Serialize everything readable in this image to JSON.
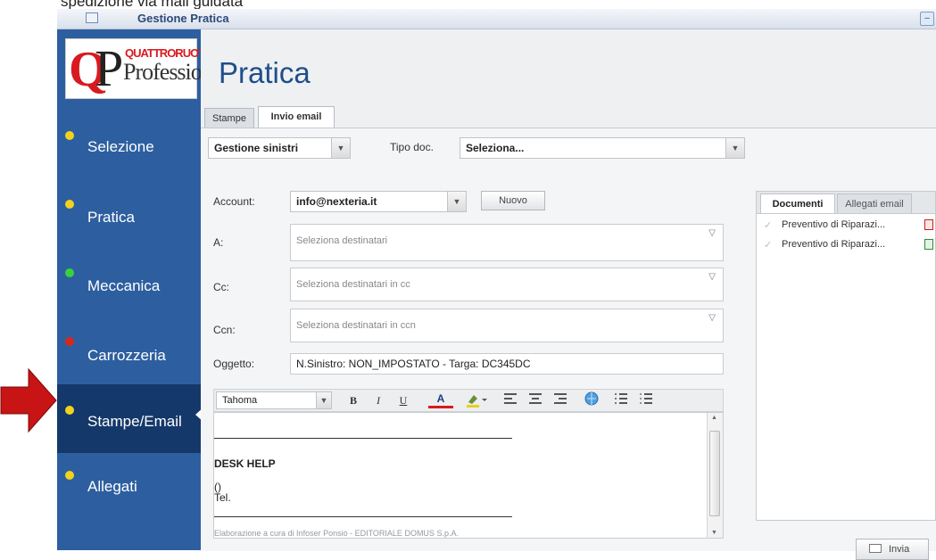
{
  "caption": "spedizione via mail guidata",
  "window": {
    "title": "Gestione Pratica",
    "minimize_label": "–"
  },
  "logo": {
    "q": "Q",
    "p": "P",
    "brand": "QUATTRORUOTE",
    "sub": "Professional"
  },
  "colors": {
    "sidebar": "#2d5fa0",
    "sidebar_active": "#14386a",
    "dot_yellow": "#f2d21b",
    "dot_green": "#3ccf3c",
    "dot_red": "#d8281c",
    "arrow": "#c81414"
  },
  "sidebar": {
    "items": [
      {
        "label": "Selezione",
        "status": "yellow"
      },
      {
        "label": "Pratica",
        "status": "yellow"
      },
      {
        "label": "Meccanica",
        "status": "green"
      },
      {
        "label": "Carrozzeria",
        "status": "red"
      },
      {
        "label": "Stampe/Email",
        "status": "yellow",
        "active": true
      },
      {
        "label": "Allegati",
        "status": "yellow"
      }
    ]
  },
  "page": {
    "title": "Pratica"
  },
  "tabs": [
    {
      "label": "Stampe"
    },
    {
      "label": "Invio email",
      "active": true
    }
  ],
  "filters": {
    "category_value": "Gestione sinistri",
    "doc_type_label": "Tipo doc.",
    "doc_type_value": "Seleziona..."
  },
  "form": {
    "account_label": "Account:",
    "account_value": "info@nexteria.it",
    "new_button": "Nuovo",
    "to_label": "A:",
    "to_placeholder": "Seleziona destinatari",
    "cc_label": "Cc:",
    "cc_placeholder": "Seleziona destinatari in cc",
    "ccn_label": "Ccn:",
    "ccn_placeholder": "Seleziona destinatari in ccn",
    "subject_label": "Oggetto:",
    "subject_value": "N.Sinistro: NON_IMPOSTATO - Targa: DC345DC"
  },
  "toolbar": {
    "font": "Tahoma",
    "bold": "B",
    "italic": "I",
    "underline": "U",
    "font_color": "A"
  },
  "editor": {
    "heading": "DESK HELP",
    "line1": "()",
    "line2": "Tel.",
    "footer": "Elaborazione a cura di Infoser Ponsio - EDITORIALE DOMUS S.p.A."
  },
  "side_panel": {
    "tabs": [
      {
        "label": "Documenti",
        "active": true
      },
      {
        "label": "Allegati email"
      }
    ],
    "documents": [
      {
        "name": "Preventivo di Riparazi...",
        "icon": "pdf-icon"
      },
      {
        "name": "Preventivo di Riparazi...",
        "icon": "excel-icon"
      }
    ]
  },
  "send_button": "Invia"
}
